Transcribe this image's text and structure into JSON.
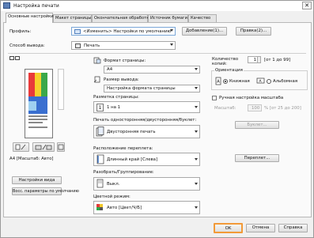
{
  "window": {
    "title": "Настройка печати",
    "close_glyph": "✕"
  },
  "tabs": [
    {
      "label": "Основные настройки",
      "active": true
    },
    {
      "label": "Макет страницы"
    },
    {
      "label": "Окончательная обработка"
    },
    {
      "label": "Источник бумаги"
    },
    {
      "label": "Качество"
    }
  ],
  "profile": {
    "label": "Профиль:",
    "value": "<Изменить> Настройки по умолчанию",
    "add_button": "Добавление(1)...",
    "edit_button": "Правка(2)..."
  },
  "output": {
    "label": "Способ вывода:",
    "value": "Печать"
  },
  "preview": {
    "caption": "A4 [Масштаб: Авто]",
    "view_settings_button": "Настройки вида",
    "restore_defaults_button": "Восс. параметры по умолчанию"
  },
  "page_size": {
    "label": "Формат страницы:",
    "value": "A4"
  },
  "output_size": {
    "label": "Размер вывода:",
    "value": "Настройка формата страницы"
  },
  "copies": {
    "label_line1": "Количество",
    "label_line2": "копий:",
    "value": "1",
    "range": "[от 1 до 99]"
  },
  "orientation": {
    "label": "Ориентация",
    "portrait": "Книжная",
    "landscape": "Альбомная",
    "selected": "portrait"
  },
  "layout": {
    "label": "Разметка страницы:",
    "value": "1 на 1"
  },
  "manual_scale": {
    "label": "Ручная настройка масштаба",
    "field_label": "Масштаб:",
    "value": "100",
    "range": "% [от 25 до 200]"
  },
  "booklet_button": "Буклет...",
  "duplex": {
    "label": "Печать односторонняя/двусторонняя/буклет:",
    "value": "Двусторонняя печать"
  },
  "binding": {
    "label": "Расположение переплета:",
    "value": "Длинный край [Слева]",
    "gutter_button": "Переплет..."
  },
  "collate": {
    "label": "Разобрать/Группирование:",
    "value": "Выкл."
  },
  "color": {
    "label": "Цветной режим:",
    "value": "Авто [Цвет/Ч/Б]"
  },
  "footer": {
    "ok": "OK",
    "cancel": "Отмена",
    "help": "Справка"
  }
}
